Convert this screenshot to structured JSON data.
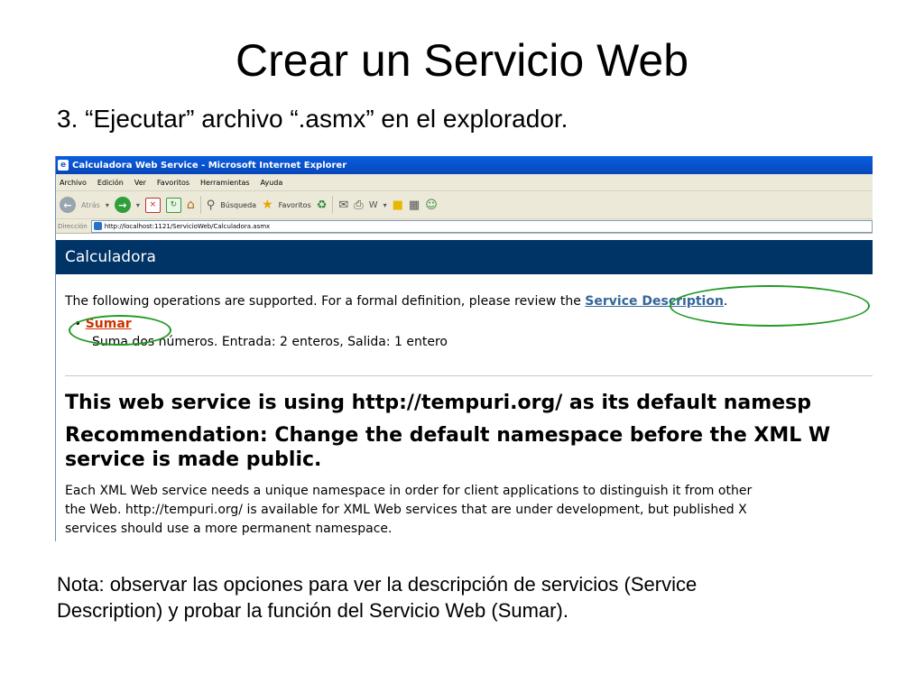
{
  "slide": {
    "title": "Crear un Servicio Web",
    "step": "3. “Ejecutar” archivo “.asmx” en el explorador.",
    "note_line1": "Nota: observar las opciones para ver la descripción de servicios (Service",
    "note_line2": "Description) y probar la función del Servicio Web (Sumar)."
  },
  "browser": {
    "window_title": "Calculadora Web Service - Microsoft Internet Explorer",
    "menu": [
      "Archivo",
      "Edición",
      "Ver",
      "Favoritos",
      "Herramientas",
      "Ayuda"
    ],
    "toolbar": {
      "back_label": "Atrás",
      "search_label": "Búsqueda",
      "favorites_label": "Favoritos"
    },
    "address": {
      "label": "Dirección",
      "url": "http://localhost:1121/ServicioWeb/Calculadora.asmx"
    }
  },
  "page": {
    "heading": "Calculadora",
    "ops_intro_prefix": "The following operations are supported. For a formal definition, please review the ",
    "service_description_link": "Service Description",
    "ops_intro_suffix": ".",
    "operation": {
      "bullet": "•",
      "name": "Sumar",
      "description": "Suma dos números. Entrada: 2 enteros, Salida: 1 entero"
    },
    "ns_heading": "This web service is using http://tempuri.org/ as its default namesp",
    "rec_heading_line1": "Recommendation: Change the default namespace before the XML W",
    "rec_heading_line2": "service is made public.",
    "body_line1": "Each XML Web service needs a unique namespace in order for client applications to distinguish it from other",
    "body_line2": "the Web. http://tempuri.org/ is available for XML Web services that are under development, but published X",
    "body_line3": "services should use a more permanent namespace."
  },
  "colors": {
    "heading_bar": "#003366",
    "highlight_ellipse": "#239a23",
    "link": "#336699",
    "sumar_link": "#cc3300"
  }
}
